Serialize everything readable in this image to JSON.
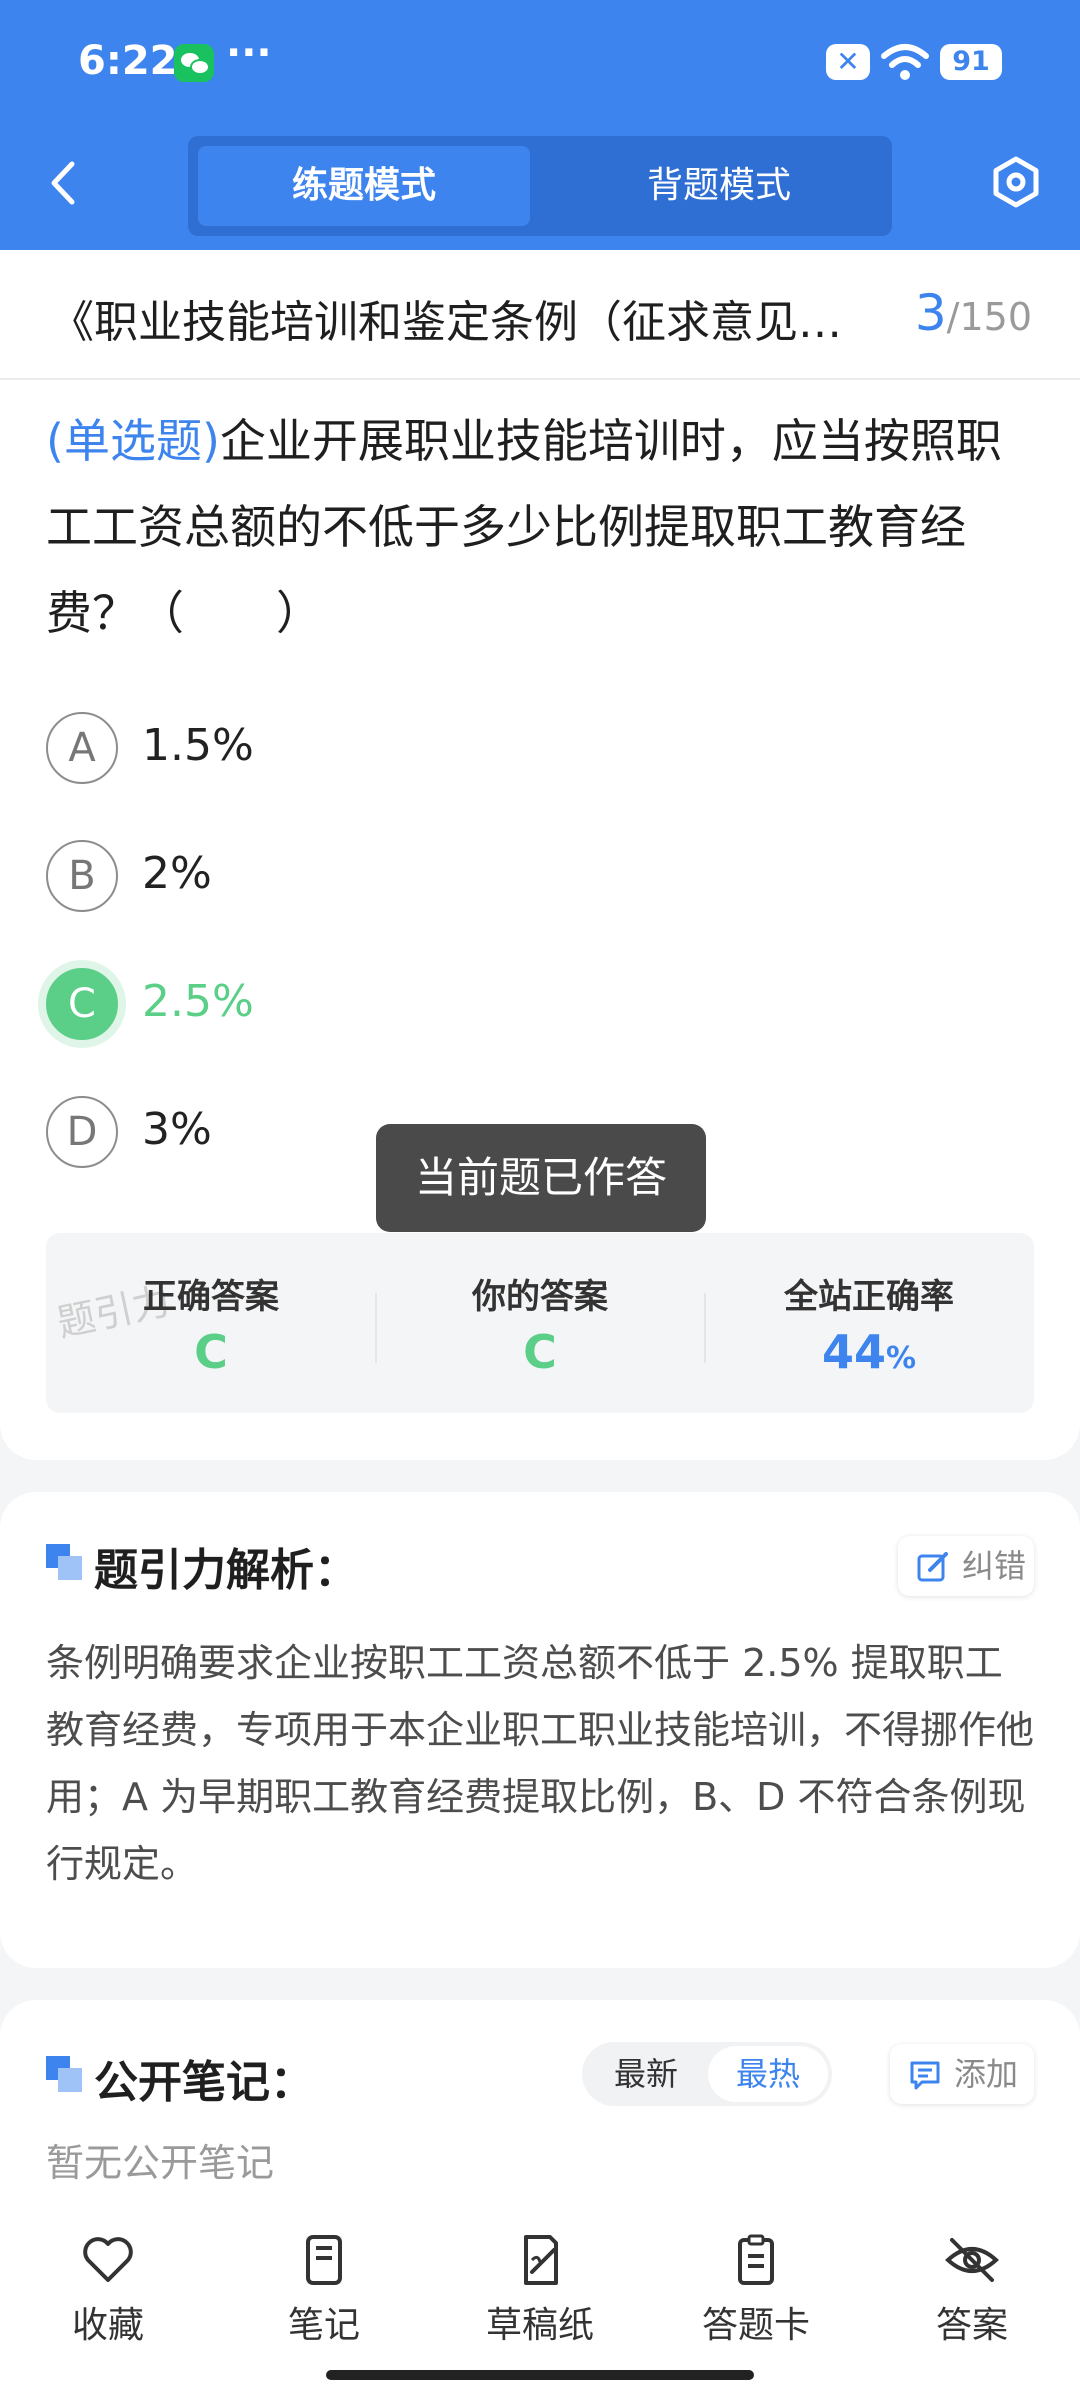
{
  "status_bar": {
    "time": "6:22",
    "overflow": "···",
    "battery": "91"
  },
  "header": {
    "tabs": [
      {
        "label": "练题模式",
        "active": true
      },
      {
        "label": "背题模式",
        "active": false
      }
    ]
  },
  "title_bar": {
    "title": "《职业技能培训和鉴定条例（征求意见稿）》",
    "current": "3",
    "total": "/150"
  },
  "question": {
    "type_label": "(单选题)",
    "text": "企业开展职业技能培训时，应当按照职工工资总额的不低于多少比例提取职工教育经费？（　　）"
  },
  "options": [
    {
      "letter": "A",
      "text": "1.5%",
      "state": "normal"
    },
    {
      "letter": "B",
      "text": "2%",
      "state": "normal"
    },
    {
      "letter": "C",
      "text": "2.5%",
      "state": "correct"
    },
    {
      "letter": "D",
      "text": "3%",
      "state": "normal"
    }
  ],
  "toast": "当前题已作答",
  "answer_summary": {
    "correct_label": "正确答案",
    "correct_value": "C",
    "yours_label": "你的答案",
    "yours_value": "C",
    "rate_label": "全站正确率",
    "rate_value": "44",
    "rate_unit": "%",
    "watermark": "题引力"
  },
  "explanation": {
    "title": "题引力解析：",
    "report_label": "纠错",
    "text": "条例明确要求企业按职工工资总额不低于 2.5% 提取职工教育经费，专项用于本企业职工职业技能培训，不得挪作他用；A 为早期职工教育经费提取比例，B、D 不符合条例现行规定。"
  },
  "notes": {
    "title": "公开笔记：",
    "sort_latest": "最新",
    "sort_hot": "最热",
    "add_label": "添加",
    "empty_text": "暂无公开笔记"
  },
  "bottom_nav": [
    {
      "label": "收藏",
      "icon": "heart-icon"
    },
    {
      "label": "笔记",
      "icon": "notebook-icon"
    },
    {
      "label": "草稿纸",
      "icon": "draft-icon"
    },
    {
      "label": "答题卡",
      "icon": "answer-card-icon"
    },
    {
      "label": "答案",
      "icon": "eye-off-icon"
    }
  ],
  "colors": {
    "primary": "#3d84ee",
    "correct": "#5bcf88",
    "toast_bg": "#4a4a4a"
  }
}
